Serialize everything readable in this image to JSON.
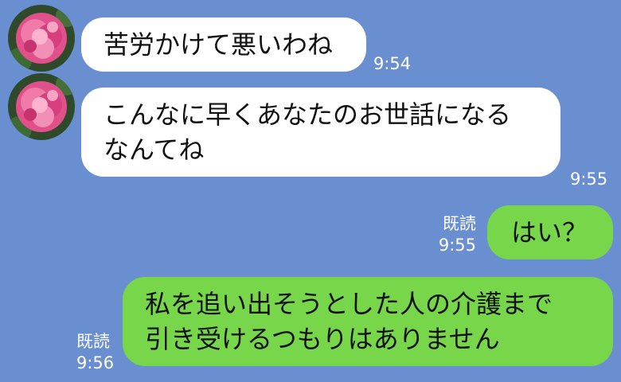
{
  "messages": [
    {
      "side": "in",
      "lines": [
        "苦労かけて悪いわね"
      ],
      "time": "9:54"
    },
    {
      "side": "in",
      "lines": [
        "こんなに早くあなたのお世話になる",
        "なんてね"
      ],
      "time": "9:55"
    },
    {
      "side": "out",
      "lines": [
        "はい？"
      ],
      "read": "既読",
      "time": "9:55"
    },
    {
      "side": "out",
      "lines": [
        "私を追い出そうとした人の介護まで",
        "引き受けるつもりはありません"
      ],
      "read": "既読",
      "time": "9:56"
    }
  ],
  "avatar_icon": "peony-flower-icon",
  "colors": {
    "background": "#6a8fd0",
    "incoming_bubble": "#ffffff",
    "outgoing_bubble": "#78d64b"
  }
}
